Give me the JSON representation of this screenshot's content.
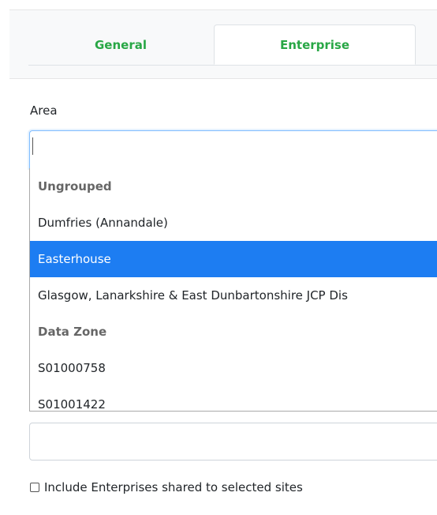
{
  "tabs": {
    "general": "General",
    "enterprise": "Enterprise"
  },
  "form": {
    "area_label": "Area",
    "area_input_value": "",
    "second_input_value": "",
    "checkbox_label": "Include Enterprises shared to selected sites",
    "checkbox_checked": false
  },
  "dropdown": {
    "items": [
      {
        "label": "Ungrouped",
        "type": "group"
      },
      {
        "label": "Dumfries (Annandale)",
        "type": "option"
      },
      {
        "label": "Easterhouse",
        "type": "option",
        "selected": true
      },
      {
        "label": "Glasgow, Lanarkshire & East Dunbartonshire JCP Dis",
        "type": "option"
      },
      {
        "label": "Data Zone",
        "type": "group"
      },
      {
        "label": "S01000758",
        "type": "option"
      },
      {
        "label": "S01001422",
        "type": "option"
      }
    ]
  },
  "colors": {
    "tab_text": "#28a745",
    "selected_bg": "#1d7df2",
    "group_text": "#666666"
  }
}
